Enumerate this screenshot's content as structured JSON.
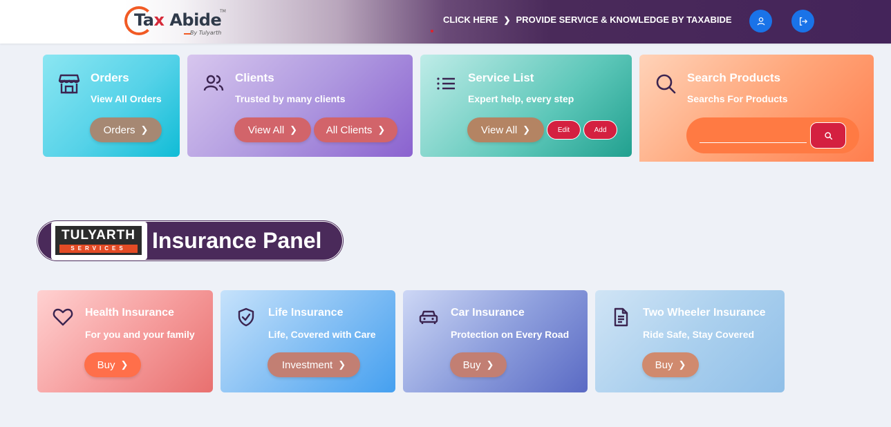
{
  "header": {
    "logo": {
      "brand_prefix": "Ta",
      "brand_x": "x",
      "brand_suffix": "Abide",
      "tm": "TM",
      "tagline": "By Tulyarth"
    },
    "nav_click_here": "CLICK HERE",
    "nav_provide": "PROVIDE SERVICE & KNOWLEDGE BY TAXABIDE",
    "profile_icon": "user-icon",
    "logout_icon": "logout-icon"
  },
  "cards": {
    "orders": {
      "title": "Orders",
      "subtitle": "View All Orders",
      "button": "Orders",
      "icon": "store-icon"
    },
    "clients": {
      "title": "Clients",
      "subtitle": "Trusted by many clients",
      "view_all": "View All",
      "all_clients": "All Clients",
      "icon": "users-icon"
    },
    "service": {
      "title": "Service List",
      "subtitle": "Expert help, every step",
      "view_all": "View All",
      "edit": "Edit",
      "add": "Add",
      "icon": "list-icon"
    },
    "search": {
      "title": "Search Products",
      "subtitle": "Searchs For Products",
      "placeholder": "",
      "icon": "search-icon"
    }
  },
  "insurance": {
    "banner_logo_top": "TULYARTH",
    "banner_logo_bottom": "SERVICES",
    "title": "Insurance Panel",
    "items": [
      {
        "title": "Health Insurance",
        "subtitle": "For you and your family",
        "button": "Buy",
        "icon": "heart-icon"
      },
      {
        "title": "Life Insurance",
        "subtitle": "Life, Covered with Care",
        "button": "Investment",
        "icon": "shield-check-icon"
      },
      {
        "title": "Car Insurance",
        "subtitle": "Protection on Every Road",
        "button": "Buy",
        "icon": "car-icon"
      },
      {
        "title": "Two Wheeler Insurance",
        "subtitle": "Ride Safe, Stay Covered",
        "button": "Buy",
        "icon": "document-icon"
      }
    ]
  },
  "colors": {
    "header_dark": "#44245a",
    "accent_blue": "#1a73e8",
    "accent_red": "#d42040",
    "banner": "#4a2a5a",
    "icon_dark": "#3b2450"
  }
}
